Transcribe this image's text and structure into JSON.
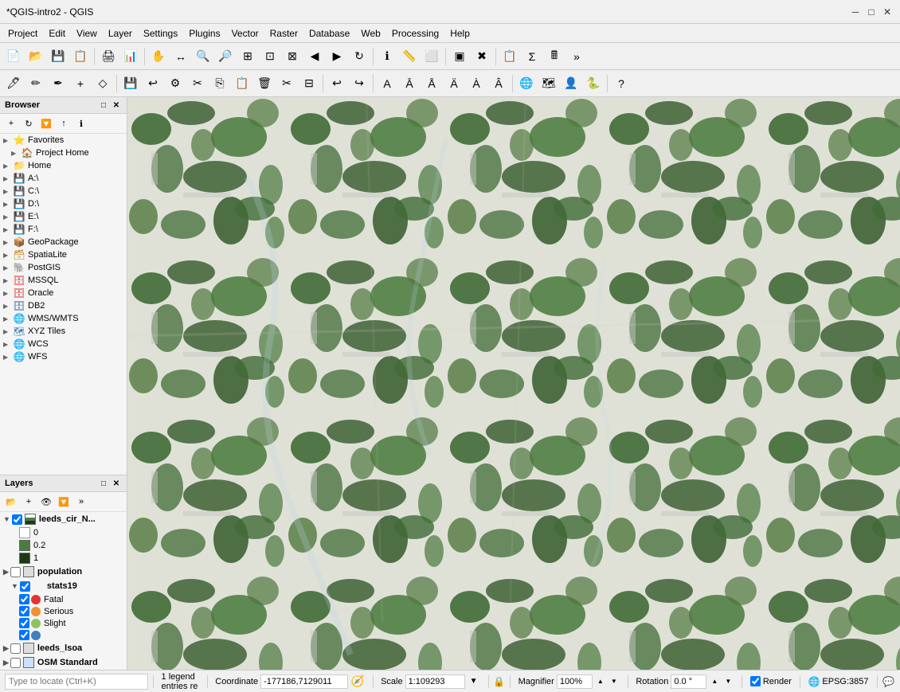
{
  "window": {
    "title": "*QGIS-intro2 - QGIS",
    "min_btn": "─",
    "max_btn": "□",
    "close_btn": "✕"
  },
  "menubar": {
    "items": [
      "Project",
      "Edit",
      "View",
      "Layer",
      "Settings",
      "Plugins",
      "Vector",
      "Raster",
      "Database",
      "Web",
      "Processing",
      "Help"
    ]
  },
  "browser": {
    "title": "Browser",
    "items": [
      {
        "label": "Favorites",
        "icon": "⭐",
        "expandable": true,
        "expanded": false,
        "indent": 0
      },
      {
        "label": "Project Home",
        "icon": "🏠",
        "expandable": true,
        "expanded": false,
        "indent": 1
      },
      {
        "label": "Home",
        "icon": "📁",
        "expandable": true,
        "expanded": false,
        "indent": 0
      },
      {
        "label": "A:\\",
        "icon": "💾",
        "expandable": true,
        "expanded": false,
        "indent": 0
      },
      {
        "label": "C:\\",
        "icon": "💾",
        "expandable": true,
        "expanded": false,
        "indent": 0
      },
      {
        "label": "D:\\",
        "icon": "💾",
        "expandable": true,
        "expanded": false,
        "indent": 0
      },
      {
        "label": "E:\\",
        "icon": "💾",
        "expandable": true,
        "expanded": false,
        "indent": 0
      },
      {
        "label": "F:\\",
        "icon": "💾",
        "expandable": true,
        "expanded": false,
        "indent": 0
      },
      {
        "label": "GeoPackage",
        "icon": "📦",
        "expandable": true,
        "expanded": false,
        "indent": 0
      },
      {
        "label": "SpatiaLite",
        "icon": "🗃",
        "expandable": true,
        "expanded": false,
        "indent": 0
      },
      {
        "label": "PostGIS",
        "icon": "🐘",
        "expandable": true,
        "expanded": false,
        "indent": 0
      },
      {
        "label": "MSSQL",
        "icon": "🗄",
        "expandable": true,
        "expanded": false,
        "indent": 0
      },
      {
        "label": "Oracle",
        "icon": "🗄",
        "expandable": true,
        "expanded": false,
        "indent": 0
      },
      {
        "label": "DB2",
        "icon": "🗄",
        "expandable": true,
        "expanded": false,
        "indent": 0
      },
      {
        "label": "WMS/WMTS",
        "icon": "🌐",
        "expandable": true,
        "expanded": false,
        "indent": 0
      },
      {
        "label": "XYZ Tiles",
        "icon": "🗺",
        "expandable": true,
        "expanded": false,
        "indent": 0
      },
      {
        "label": "WCS",
        "icon": "🌐",
        "expandable": true,
        "expanded": false,
        "indent": 0
      },
      {
        "label": "WFS",
        "icon": "🌐",
        "expandable": true,
        "expanded": false,
        "indent": 0
      }
    ]
  },
  "layers": {
    "title": "Layers",
    "items": [
      {
        "name": "leeds_cir_N...",
        "checked": true,
        "type": "raster",
        "expanded": true,
        "indent": 0,
        "legend": [
          {
            "label": "0",
            "color": "#ffffff",
            "type": "rect"
          },
          {
            "label": "0.2",
            "color": "#4a7c3f",
            "type": "rect"
          },
          {
            "label": "1",
            "color": "#1a3a15",
            "type": "rect"
          }
        ]
      },
      {
        "name": "population",
        "checked": false,
        "type": "vector",
        "expanded": false,
        "indent": 0
      },
      {
        "name": "stats19",
        "checked": true,
        "type": "points",
        "expanded": true,
        "indent": 1,
        "legend": [
          {
            "label": "Fatal",
            "color": "#e63232",
            "type": "circle"
          },
          {
            "label": "Serious",
            "color": "#f09030",
            "type": "circle"
          },
          {
            "label": "Slight",
            "color": "#90c060",
            "type": "circle"
          },
          {
            "label": "",
            "color": "#4080c0",
            "type": "circle"
          }
        ]
      },
      {
        "name": "leeds_lsoa",
        "checked": false,
        "type": "polygon",
        "expanded": false,
        "indent": 0
      },
      {
        "name": "OSM Standard",
        "checked": false,
        "type": "raster",
        "expanded": false,
        "indent": 0
      }
    ]
  },
  "statusbar": {
    "search_placeholder": "Type to locate (Ctrl+K)",
    "legend_info": "1 legend entries re",
    "coordinate_label": "Coordinate",
    "coordinate_value": "-177186,7129011",
    "scale_label": "Scale",
    "scale_value": "1:109293",
    "magnifier_label": "Magnifier",
    "magnifier_value": "100%",
    "rotation_label": "Rotation",
    "rotation_value": "0.0 °",
    "render_label": "Render",
    "epsg_label": "EPSG:3857"
  },
  "icons": {
    "expand": "▶",
    "collapse": "▼",
    "new": "📄",
    "open": "📂",
    "save": "💾",
    "pan": "✋",
    "zoom_in": "🔍",
    "zoom_out": "🔍",
    "settings": "⚙",
    "lock": "🔒"
  }
}
